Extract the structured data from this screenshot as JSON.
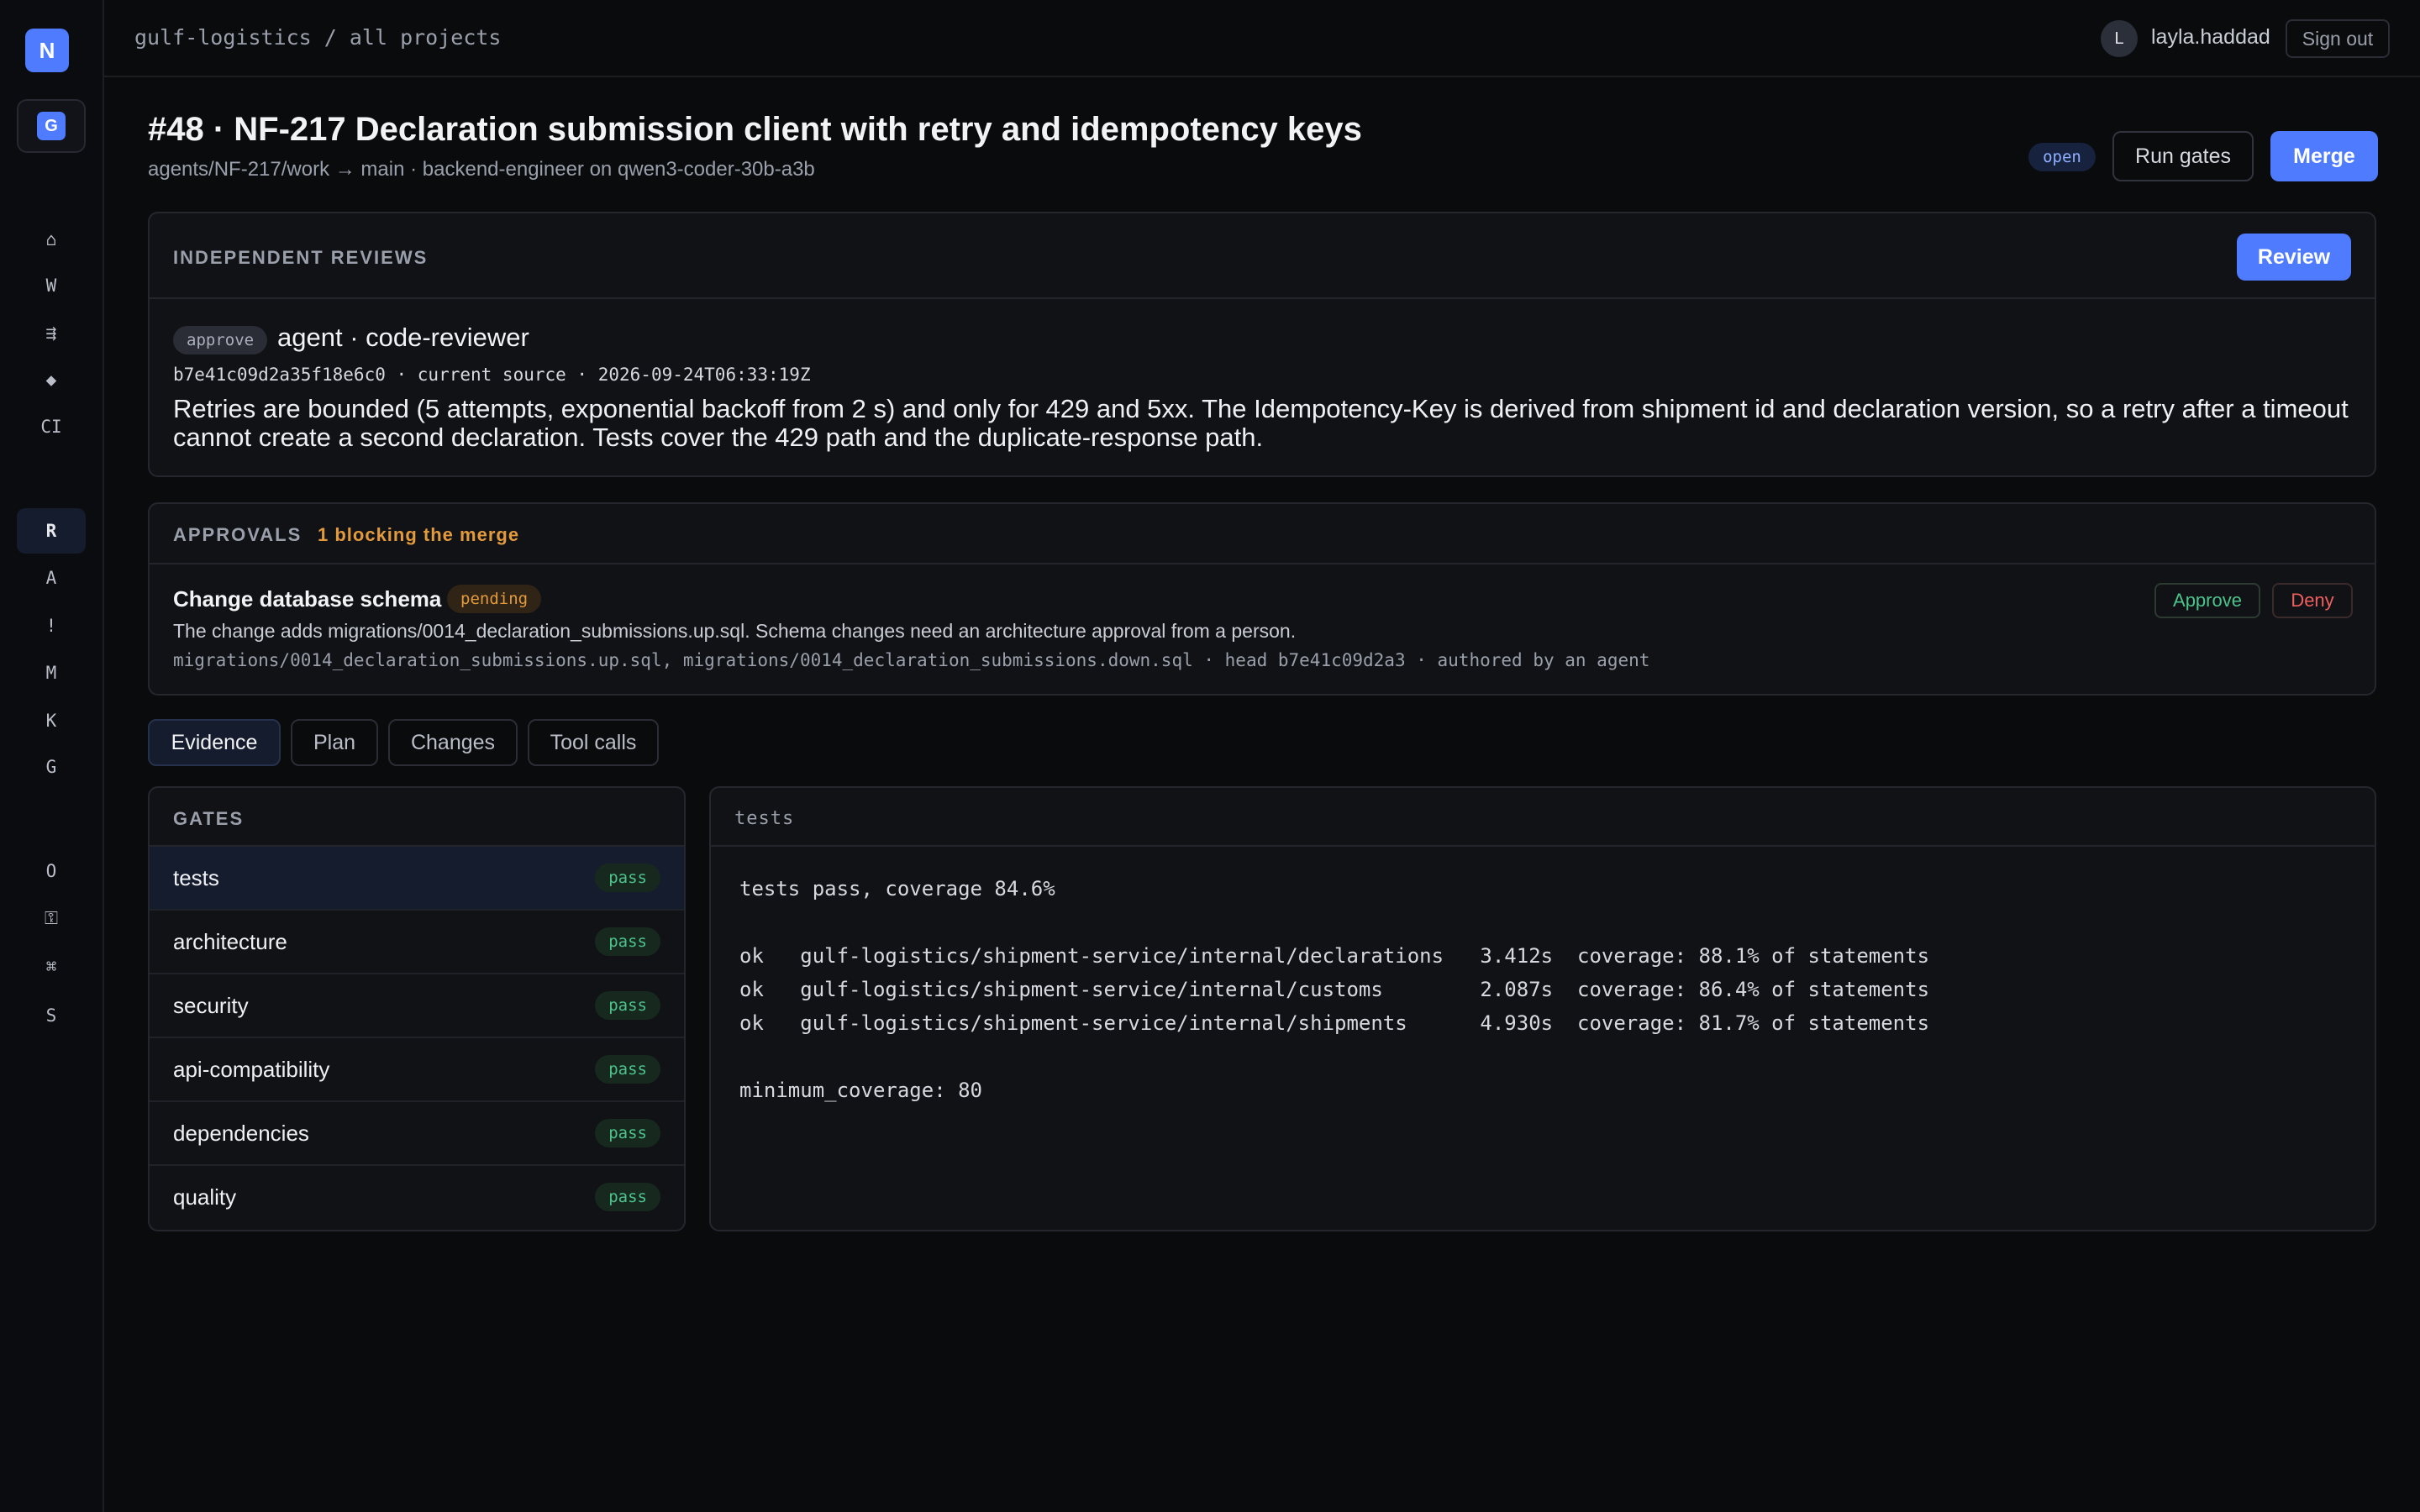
{
  "sidebar": {
    "logo": "N",
    "workspace": "G",
    "nav_top": [
      "⌂",
      "W",
      "⇶",
      "◆",
      "CI"
    ],
    "nav_mid": [
      "R",
      "A",
      "!",
      "M",
      "K",
      "G"
    ],
    "nav_bottom": [
      "O",
      "⚿",
      "⌘",
      "S"
    ]
  },
  "topbar": {
    "breadcrumb": "gulf-logistics / all projects",
    "user_initial": "L",
    "user_name": "layla.haddad",
    "sign_out": "Sign out"
  },
  "header": {
    "title": "#48 · NF-217 Declaration submission client with retry and idempotency keys",
    "subtitle": "agents/NF-217/work → main · backend-engineer on qwen3-coder-30b-a3b",
    "status": "open",
    "run_gates": "Run gates",
    "merge": "Merge"
  },
  "reviews": {
    "label": "INDEPENDENT REVIEWS",
    "review_button": "Review",
    "verdict": "approve",
    "reviewer": "agent · code-reviewer",
    "meta": "b7e41c09d2a35f18e6c0 · current source · 2026-09-24T06:33:19Z",
    "body": "Retries are bounded (5 attempts, exponential backoff from 2 s) and only for 429 and 5xx. The Idempotency-Key is derived from shipment id and declaration version, so a retry after a timeout cannot create a second declaration. Tests cover the 429 path and the duplicate-response path."
  },
  "approvals": {
    "label": "APPROVALS",
    "blocking": "1 blocking the merge",
    "item_title": "Change database schema",
    "item_status": "pending",
    "item_desc": "The change adds migrations/0014_declaration_submissions.up.sql. Schema changes need an architecture approval from a person.",
    "item_meta": "migrations/0014_declaration_submissions.up.sql, migrations/0014_declaration_submissions.down.sql · head b7e41c09d2a3 · authored by an agent",
    "approve": "Approve",
    "deny": "Deny"
  },
  "tabs": [
    "Evidence",
    "Plan",
    "Changes",
    "Tool calls"
  ],
  "gates": {
    "label": "GATES",
    "items": [
      {
        "name": "tests",
        "status": "pass"
      },
      {
        "name": "architecture",
        "status": "pass"
      },
      {
        "name": "security",
        "status": "pass"
      },
      {
        "name": "api-compatibility",
        "status": "pass"
      },
      {
        "name": "dependencies",
        "status": "pass"
      },
      {
        "name": "quality",
        "status": "pass"
      }
    ]
  },
  "output": {
    "title": "tests",
    "lines": [
      "tests pass, coverage 84.6%",
      "",
      "ok   gulf-logistics/shipment-service/internal/declarations   3.412s  coverage: 88.1% of statements",
      "ok   gulf-logistics/shipment-service/internal/customs        2.087s  coverage: 86.4% of statements",
      "ok   gulf-logistics/shipment-service/internal/shipments      4.930s  coverage: 81.7% of statements",
      "",
      "minimum_coverage: 80"
    ]
  },
  "colors": {
    "accent": "#4f7cff",
    "pass": "#4cc38a",
    "pending": "#e39a3c",
    "deny": "#ef5f5f"
  }
}
